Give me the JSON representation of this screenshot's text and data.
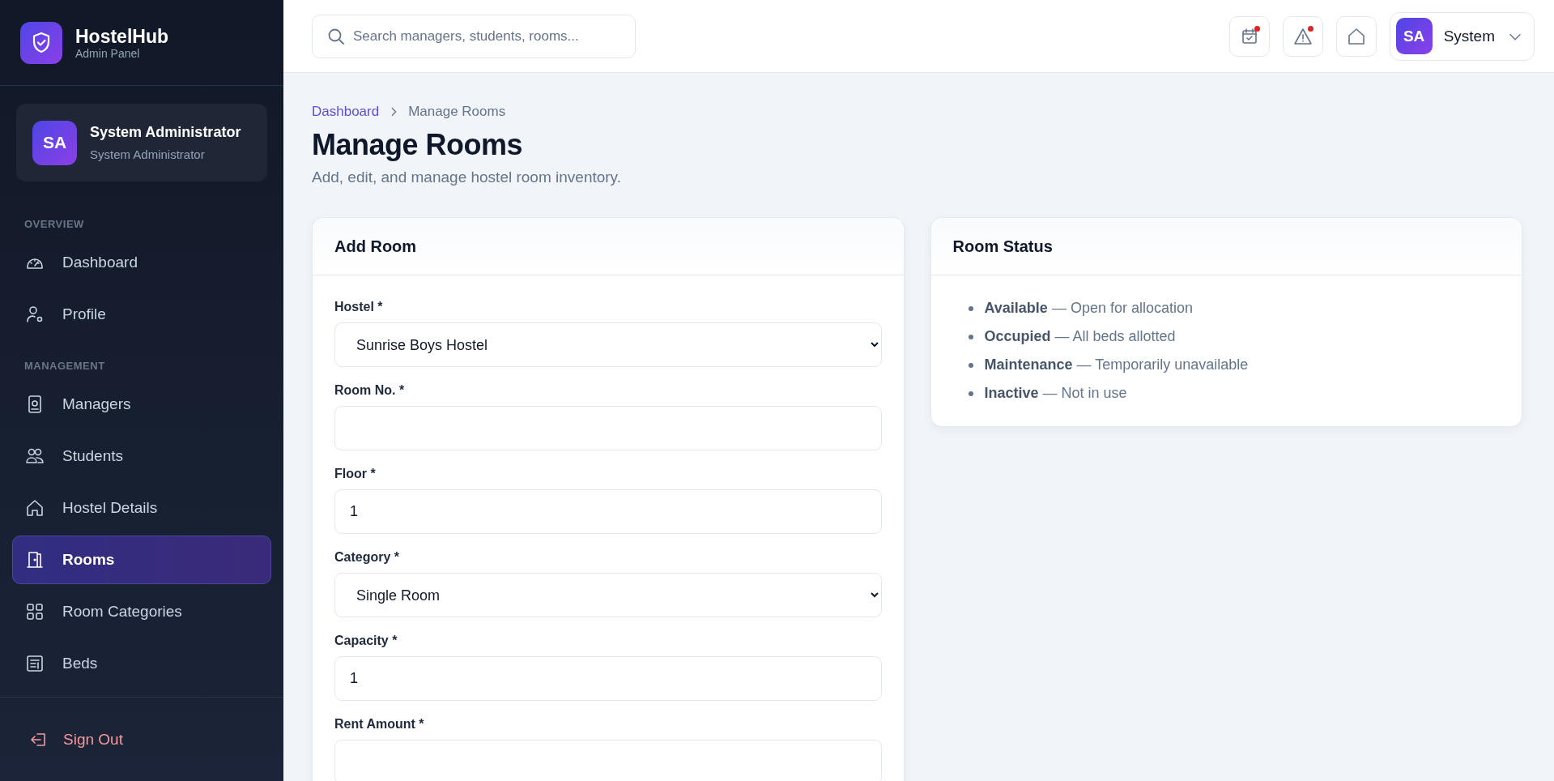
{
  "brand": {
    "name": "HostelHub",
    "subtitle": "Admin Panel"
  },
  "profile": {
    "initials": "SA",
    "name": "System Administrator",
    "role": "System Administrator"
  },
  "nav": [
    {
      "heading": "OVERVIEW",
      "items": [
        {
          "label": "Dashboard",
          "kind": "gauge",
          "selected": false
        },
        {
          "label": "Profile",
          "kind": "user-gear",
          "selected": false
        }
      ]
    },
    {
      "heading": "MANAGEMENT",
      "items": [
        {
          "label": "Managers",
          "kind": "badge",
          "selected": false
        },
        {
          "label": "Students",
          "kind": "users",
          "selected": false
        },
        {
          "label": "Hostel Details",
          "kind": "home",
          "selected": false
        },
        {
          "label": "Rooms",
          "kind": "door",
          "selected": true
        },
        {
          "label": "Room Categories",
          "kind": "grid",
          "selected": false
        },
        {
          "label": "Beds",
          "kind": "list",
          "selected": false
        }
      ]
    }
  ],
  "sign_out": "Sign Out",
  "topbar": {
    "search": {
      "placeholder": "Search managers, students, rooms..."
    },
    "actions": [
      {
        "kind": "calendar",
        "alert": true
      },
      {
        "kind": "warning",
        "alert": true
      },
      {
        "kind": "home",
        "alert": false
      }
    ],
    "user": {
      "initials": "SA",
      "name": "System"
    }
  },
  "breadcrumb": [
    {
      "label": "Dashboard",
      "kind": "link"
    },
    {
      "label": "Manage Rooms",
      "kind": "current"
    }
  ],
  "page": {
    "title": "Manage Rooms",
    "subtitle": "Add, edit, and manage hostel room inventory."
  },
  "form": {
    "title": "Add Room",
    "fields": [
      {
        "label": "Hostel *",
        "kind": "select",
        "value": "Sunrise Boys Hostel"
      },
      {
        "label": "Room No. *",
        "kind": "input"
      },
      {
        "label": "Floor *",
        "kind": "input",
        "value": "1"
      },
      {
        "label": "Category *",
        "kind": "select",
        "value": "Single Room"
      },
      {
        "label": "Capacity *",
        "kind": "input",
        "value": "1"
      },
      {
        "label": "Rent Amount *",
        "kind": "input"
      }
    ]
  },
  "status_card": {
    "title": "Room Status",
    "items": [
      "**Available** — Open for allocation",
      "**Occupied** — All beds allotted",
      "**Maintenance** — Temporarily unavailable",
      "**Inactive** — Not in use"
    ]
  }
}
